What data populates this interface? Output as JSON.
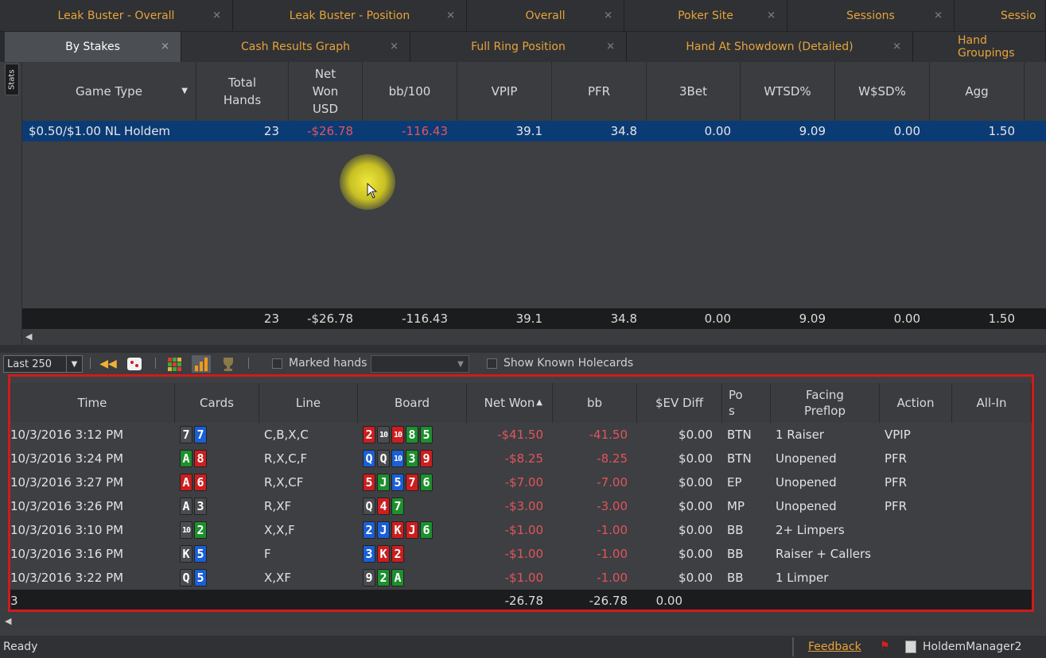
{
  "tabs_row1": [
    {
      "label": "Leak Buster - Overall"
    },
    {
      "label": "Leak Buster - Position"
    },
    {
      "label": "Overall"
    },
    {
      "label": "Poker Site"
    },
    {
      "label": "Sessions"
    },
    {
      "label": "Sessio"
    }
  ],
  "tabs_row2": [
    {
      "label": "By Stakes"
    },
    {
      "label": "Cash Results Graph"
    },
    {
      "label": "Full Ring Position"
    },
    {
      "label": "Hand At Showdown (Detailed)"
    },
    {
      "label": "Hand Groupings"
    }
  ],
  "sidebar": {
    "stats_label": "Stats"
  },
  "stats_table": {
    "headers": [
      "Game Type",
      "Total\nHands",
      "Net\nWon\nUSD",
      "bb/100",
      "VPIP",
      "PFR",
      "3Bet",
      "WTSD%",
      "W$SD%",
      "Agg"
    ],
    "row": {
      "game_type": "$0.50/$1.00 NL Holdem",
      "total_hands": "23",
      "net_won": "-$26.78",
      "bb100": "-116.43",
      "vpip": "39.1",
      "pfr": "34.8",
      "threebet": "0.00",
      "wtsd": "9.09",
      "wsd": "0.00",
      "agg": "1.50"
    },
    "totals": {
      "total_hands": "23",
      "net_won": "-$26.78",
      "bb100": "-116.43",
      "vpip": "39.1",
      "pfr": "34.8",
      "threebet": "0.00",
      "wtsd": "9.09",
      "wsd": "0.00",
      "agg": "1.50"
    }
  },
  "toolbar": {
    "range": "Last 250",
    "marked_hands": "Marked hands",
    "show_holecards": "Show Known Holecards"
  },
  "hands_table": {
    "headers": {
      "time": "Time",
      "cards": "Cards",
      "line": "Line",
      "board": "Board",
      "net_won": "Net Won",
      "bb": "bb",
      "ev_diff": "$EV Diff",
      "pos": "Po\ns",
      "facing": "Facing\nPreflop",
      "action": "Action",
      "allin": "All-In"
    },
    "rows": [
      {
        "time": "10/3/2016 3:12 PM",
        "cards": [
          {
            "r": "7",
            "c": "gray"
          },
          {
            "r": "7",
            "c": "blue"
          }
        ],
        "line": "C,B,X,C",
        "board": [
          {
            "r": "2",
            "c": "red"
          },
          {
            "r": "10",
            "c": "gray"
          },
          {
            "r": "10",
            "c": "red"
          },
          {
            "r": "8",
            "c": "green"
          },
          {
            "r": "5",
            "c": "green"
          }
        ],
        "net_won": "-$41.50",
        "bb": "-41.50",
        "ev": "$0.00",
        "pos": "BTN",
        "facing": "1 Raiser",
        "action": "VPIP"
      },
      {
        "time": "10/3/2016 3:24 PM",
        "cards": [
          {
            "r": "A",
            "c": "green"
          },
          {
            "r": "8",
            "c": "red"
          }
        ],
        "line": "R,X,C,F",
        "board": [
          {
            "r": "Q",
            "c": "blue"
          },
          {
            "r": "Q",
            "c": "gray"
          },
          {
            "r": "10",
            "c": "blue"
          },
          {
            "r": "3",
            "c": "green"
          },
          {
            "r": "9",
            "c": "red"
          }
        ],
        "net_won": "-$8.25",
        "bb": "-8.25",
        "ev": "$0.00",
        "pos": "BTN",
        "facing": "Unopened",
        "action": "PFR"
      },
      {
        "time": "10/3/2016 3:27 PM",
        "cards": [
          {
            "r": "A",
            "c": "red"
          },
          {
            "r": "6",
            "c": "red"
          }
        ],
        "line": "R,X,CF",
        "board": [
          {
            "r": "5",
            "c": "red"
          },
          {
            "r": "J",
            "c": "green"
          },
          {
            "r": "5",
            "c": "blue"
          },
          {
            "r": "7",
            "c": "red"
          },
          {
            "r": "6",
            "c": "green"
          }
        ],
        "net_won": "-$7.00",
        "bb": "-7.00",
        "ev": "$0.00",
        "pos": "EP",
        "facing": "Unopened",
        "action": "PFR"
      },
      {
        "time": "10/3/2016 3:26 PM",
        "cards": [
          {
            "r": "A",
            "c": "gray"
          },
          {
            "r": "3",
            "c": "gray"
          }
        ],
        "line": "R,XF",
        "board": [
          {
            "r": "Q",
            "c": "gray"
          },
          {
            "r": "4",
            "c": "red"
          },
          {
            "r": "7",
            "c": "green"
          }
        ],
        "net_won": "-$3.00",
        "bb": "-3.00",
        "ev": "$0.00",
        "pos": "MP",
        "facing": "Unopened",
        "action": "PFR"
      },
      {
        "time": "10/3/2016 3:10 PM",
        "cards": [
          {
            "r": "10",
            "c": "gray"
          },
          {
            "r": "2",
            "c": "green"
          }
        ],
        "line": "X,X,F",
        "board": [
          {
            "r": "2",
            "c": "blue"
          },
          {
            "r": "J",
            "c": "blue"
          },
          {
            "r": "K",
            "c": "red"
          },
          {
            "r": "J",
            "c": "red"
          },
          {
            "r": "6",
            "c": "green"
          }
        ],
        "net_won": "-$1.00",
        "bb": "-1.00",
        "ev": "$0.00",
        "pos": "BB",
        "facing": "2+ Limpers",
        "action": ""
      },
      {
        "time": "10/3/2016 3:16 PM",
        "cards": [
          {
            "r": "K",
            "c": "gray"
          },
          {
            "r": "5",
            "c": "blue"
          }
        ],
        "line": "F",
        "board": [
          {
            "r": "3",
            "c": "blue"
          },
          {
            "r": "K",
            "c": "red"
          },
          {
            "r": "2",
            "c": "red"
          }
        ],
        "net_won": "-$1.00",
        "bb": "-1.00",
        "ev": "$0.00",
        "pos": "BB",
        "facing": "Raiser + Callers",
        "action": ""
      },
      {
        "time": "10/3/2016 3:22 PM",
        "cards": [
          {
            "r": "Q",
            "c": "gray"
          },
          {
            "r": "5",
            "c": "blue"
          }
        ],
        "line": "X,XF",
        "board": [
          {
            "r": "9",
            "c": "gray"
          },
          {
            "r": "2",
            "c": "green"
          },
          {
            "r": "A",
            "c": "green"
          }
        ],
        "net_won": "-$1.00",
        "bb": "-1.00",
        "ev": "$0.00",
        "pos": "BB",
        "facing": "1 Limper",
        "action": ""
      }
    ],
    "totals": {
      "count": "3",
      "net_won": "-26.78",
      "bb": "-26.78",
      "ev": "0.00"
    }
  },
  "statusbar": {
    "ready": "Ready",
    "feedback": "Feedback",
    "database": "HoldemManager2"
  },
  "colors": {
    "accent": "#e8a33a",
    "negative": "#e2545d",
    "selected_row": "#0b3b75",
    "highlight_box": "#d01b1b"
  }
}
